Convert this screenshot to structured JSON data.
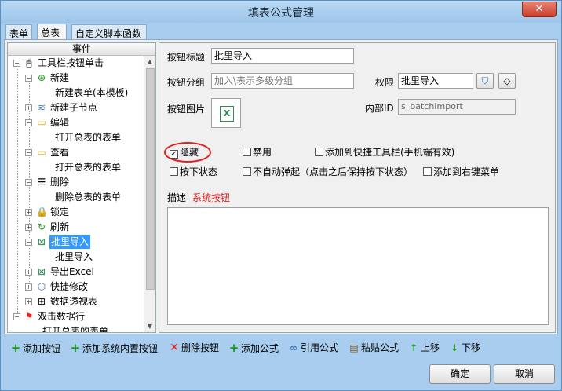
{
  "window": {
    "title": "填表公式管理",
    "close_glyph": "✕"
  },
  "tabs": [
    {
      "label": "表单"
    },
    {
      "label": "总表"
    },
    {
      "label": "自定义脚本函数"
    }
  ],
  "tree": {
    "header": "事件",
    "nodes": {
      "toolbar_click": "工具栏按钮单击",
      "new": "新建",
      "new_form_template": "新建表单(本模板)",
      "new_child": "新建子节点",
      "edit": "编辑",
      "open_summary_1": "打开总表的表单",
      "view": "查看",
      "open_summary_2": "打开总表的表单",
      "delete": "删除",
      "delete_summary": "删除总表的表单",
      "lock": "锁定",
      "refresh": "刷新",
      "batch_import": "批里导入",
      "batch_import_child": "批里导入",
      "export_excel": "导出Excel",
      "quick_edit": "快捷修改",
      "pivot": "数据透视表",
      "double_click": "双击数据行",
      "open_summary_3": "打开总表的表单"
    }
  },
  "form": {
    "button_title_label": "按钮标题",
    "button_title_value": "批里导入",
    "button_group_label": "按钮分组",
    "button_group_placeholder": "加入\\表示多级分组",
    "permission_label": "权限",
    "permission_value": "批里导入",
    "button_image_label": "按钮图片",
    "internal_id_label": "内部ID",
    "internal_id_value": "s_batchImport",
    "checkboxes": {
      "hidden": "隐藏",
      "disabled": "禁用",
      "add_quick_toolbar": "添加到快捷工具栏(手机端有效)",
      "press_state": "按下状态",
      "no_auto_popup": "不自动弹起（点击之后保持按下状态）",
      "add_context_menu": "添加到右键菜单"
    },
    "checkbox_states": {
      "hidden": true
    },
    "desc_label": "描述",
    "desc_tag": "系统按钮"
  },
  "toolbar": {
    "add_button": "添加按钮",
    "add_builtin_button": "添加系统内置按钮",
    "delete_button": "删除按钮",
    "add_formula": "添加公式",
    "ref_formula": "引用公式",
    "paste_formula": "粘贴公式",
    "move_up": "上移",
    "move_down": "下移"
  },
  "dialog": {
    "ok": "确定",
    "cancel": "取消"
  },
  "colors": {
    "accent_red": "#e02020",
    "add_green": "#1a9a1a",
    "selection_blue": "#3399ff"
  }
}
